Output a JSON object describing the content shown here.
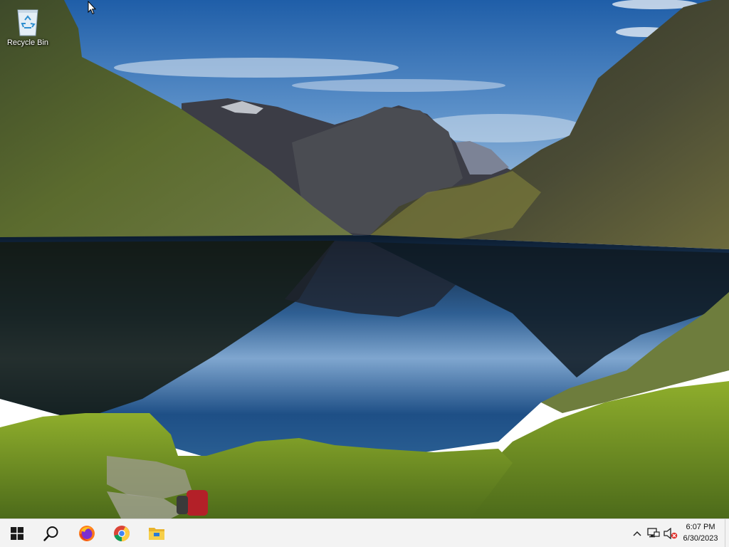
{
  "desktop": {
    "icons": [
      {
        "label": "Recycle Bin",
        "icon": "recycle-bin-icon"
      }
    ]
  },
  "taskbar": {
    "pinned": [
      {
        "name": "start",
        "icon": "windows-logo-icon"
      },
      {
        "name": "search",
        "icon": "search-icon"
      },
      {
        "name": "firefox",
        "icon": "firefox-icon"
      },
      {
        "name": "chrome",
        "icon": "chrome-icon"
      },
      {
        "name": "file-explorer",
        "icon": "folder-icon"
      }
    ],
    "tray": {
      "icons": [
        "chevron-up-icon",
        "network-icon",
        "volume-muted-icon"
      ],
      "time": "6:07 PM",
      "date": "6/30/2023"
    }
  }
}
